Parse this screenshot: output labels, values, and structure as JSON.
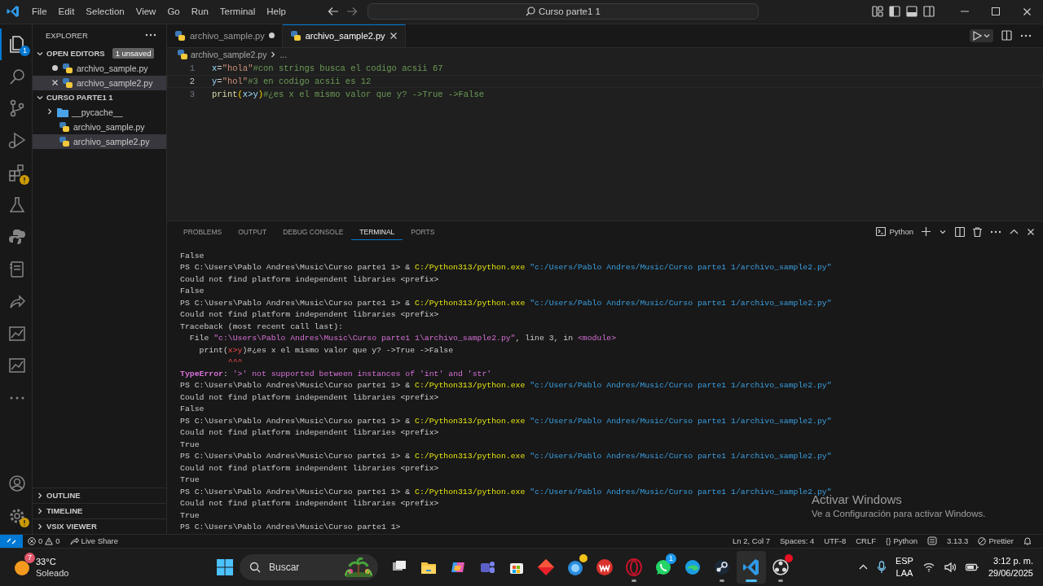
{
  "title_bar": {
    "menu": [
      "File",
      "Edit",
      "Selection",
      "View",
      "Go",
      "Run",
      "Terminal",
      "Help"
    ],
    "command_center": "Curso parte1 1"
  },
  "activity_bar": {
    "items": [
      {
        "kind": "explorer",
        "selected": true,
        "warning": false,
        "badge": "1"
      },
      {
        "kind": "search",
        "selected": false,
        "warning": false
      },
      {
        "kind": "source-control",
        "selected": false,
        "warning": false
      },
      {
        "kind": "run-debug",
        "selected": false,
        "warning": false
      },
      {
        "kind": "extensions",
        "selected": false,
        "warning": true
      },
      {
        "kind": "testing",
        "selected": false,
        "warning": false
      },
      {
        "kind": "python",
        "selected": false,
        "warning": false
      },
      {
        "kind": "notebook",
        "selected": false,
        "warning": false
      },
      {
        "kind": "live-share",
        "selected": false,
        "warning": false
      },
      {
        "kind": "chart",
        "selected": false,
        "warning": false
      },
      {
        "kind": "chart",
        "selected": false,
        "warning": false
      },
      {
        "kind": "more",
        "selected": false,
        "warning": false
      }
    ],
    "bottom": [
      {
        "kind": "account",
        "selected": false,
        "warning": false
      },
      {
        "kind": "settings",
        "selected": false,
        "warning": true
      }
    ]
  },
  "sidebar": {
    "title": "EXPLORER",
    "sections": [
      {
        "kind": "open-editors",
        "title": "OPEN EDITORS",
        "expanded": true,
        "badge": "1 unsaved",
        "items": [
          {
            "label": "archivo_sample.py",
            "kind": "python",
            "dirty": true,
            "selected": false
          },
          {
            "label": "archivo_sample2.py",
            "kind": "python",
            "dirty": false,
            "selected": true
          }
        ]
      },
      {
        "kind": "tree",
        "title": "CURSO PARTE1 1",
        "expanded": true,
        "items": [
          {
            "label": "__pycache__",
            "kind": "folder",
            "expanded": false,
            "selected": false
          },
          {
            "label": "archivo_sample.py",
            "kind": "python",
            "selected": false
          },
          {
            "label": "archivo_sample2.py",
            "kind": "python",
            "selected": true
          }
        ]
      },
      {
        "kind": "view",
        "title": "OUTLINE",
        "expanded": false
      },
      {
        "kind": "view",
        "title": "TIMELINE",
        "expanded": false
      },
      {
        "kind": "view",
        "title": "VSIX VIEWER",
        "expanded": false
      }
    ]
  },
  "editor": {
    "tabs": [
      {
        "label": "archivo_sample.py",
        "dirty": true,
        "selected": false
      },
      {
        "label": "archivo_sample2.py",
        "dirty": false,
        "selected": true
      }
    ],
    "breadcrumb": {
      "file": "archivo_sample2.py",
      "rest": "..."
    },
    "lines": [
      {
        "number": "1",
        "active": false,
        "tokens": [
          {
            "text": "x",
            "kind": "var"
          },
          {
            "text": "=",
            "kind": "op"
          },
          {
            "text": "\"hola\"",
            "kind": "str"
          },
          {
            "text": "#con strings busca el codigo acsii 67",
            "kind": "comment"
          }
        ]
      },
      {
        "number": "2",
        "active": true,
        "tokens": [
          {
            "text": "y",
            "kind": "var"
          },
          {
            "text": "=",
            "kind": "op"
          },
          {
            "text": "\"hol\"",
            "kind": "str"
          },
          {
            "text": "#3 en codigo acsii es 12",
            "kind": "comment"
          }
        ]
      },
      {
        "number": "3",
        "active": false,
        "tokens": [
          {
            "text": "print",
            "kind": "func"
          },
          {
            "text": "(",
            "kind": "bracket"
          },
          {
            "text": "x>y",
            "kind": "var"
          },
          {
            "text": ")",
            "kind": "bracket"
          },
          {
            "text": "#¿es x el mismo valor que y? ->True ->False",
            "kind": "comment"
          }
        ]
      }
    ]
  },
  "panel": {
    "tabs": [
      {
        "label": "PROBLEMS",
        "selected": false
      },
      {
        "label": "OUTPUT",
        "selected": false
      },
      {
        "label": "DEBUG CONSOLE",
        "selected": false
      },
      {
        "label": "TERMINAL",
        "selected": true
      },
      {
        "label": "PORTS",
        "selected": false
      }
    ],
    "terminal_name": "Python",
    "lines": [
      [
        {
          "text": "False",
          "kind": "plain"
        }
      ],
      [
        {
          "text": "PS C:\\Users\\Pablo Andres\\Music\\Curso parte1 1> & ",
          "kind": "plain"
        },
        {
          "text": "C:/Python313/python.exe",
          "kind": "exe"
        },
        {
          "text": " \"c:/Users/Pablo Andres/Music/Curso parte1 1/archivo_sample2.py\"",
          "kind": "arg"
        }
      ],
      [
        {
          "text": "Could not find platform independent libraries <prefix>",
          "kind": "plain"
        }
      ],
      [
        {
          "text": "False",
          "kind": "plain"
        }
      ],
      [
        {
          "text": "PS C:\\Users\\Pablo Andres\\Music\\Curso parte1 1> & ",
          "kind": "plain"
        },
        {
          "text": "C:/Python313/python.exe",
          "kind": "exe"
        },
        {
          "text": " \"c:/Users/Pablo Andres/Music/Curso parte1 1/archivo_sample2.py\"",
          "kind": "arg"
        }
      ],
      [
        {
          "text": "Could not find platform independent libraries <prefix>",
          "kind": "plain"
        }
      ],
      [
        {
          "text": "Traceback (most recent call last):",
          "kind": "plain"
        }
      ],
      [
        {
          "text": "  File ",
          "kind": "plain"
        },
        {
          "text": "\"c:\\Users\\Pablo Andres\\Music\\Curso parte1 1\\archivo_sample2.py\"",
          "kind": "path"
        },
        {
          "text": ", line 3, in ",
          "kind": "plain"
        },
        {
          "text": "<module>",
          "kind": "path"
        }
      ],
      [
        {
          "text": "    print(",
          "kind": "plain"
        },
        {
          "text": "x>y",
          "kind": "error"
        },
        {
          "text": ")#¿es x el mismo valor que y? ->True ->False",
          "kind": "plain"
        }
      ],
      [
        {
          "text": "          ^^^",
          "kind": "error"
        }
      ],
      [
        {
          "text": "TypeError",
          "kind": "errtype"
        },
        {
          "text": ": ",
          "kind": "plain"
        },
        {
          "text": "'>' not supported between instances of 'int' and 'str'",
          "kind": "path"
        }
      ],
      [
        {
          "text": "PS C:\\Users\\Pablo Andres\\Music\\Curso parte1 1> & ",
          "kind": "plain"
        },
        {
          "text": "C:/Python313/python.exe",
          "kind": "exe"
        },
        {
          "text": " \"c:/Users/Pablo Andres/Music/Curso parte1 1/archivo_sample2.py\"",
          "kind": "arg"
        }
      ],
      [
        {
          "text": "Could not find platform independent libraries <prefix>",
          "kind": "plain"
        }
      ],
      [
        {
          "text": "False",
          "kind": "plain"
        }
      ],
      [
        {
          "text": "PS C:\\Users\\Pablo Andres\\Music\\Curso parte1 1> & ",
          "kind": "plain"
        },
        {
          "text": "C:/Python313/python.exe",
          "kind": "exe"
        },
        {
          "text": " \"c:/Users/Pablo Andres/Music/Curso parte1 1/archivo_sample2.py\"",
          "kind": "arg"
        }
      ],
      [
        {
          "text": "Could not find platform independent libraries <prefix>",
          "kind": "plain"
        }
      ],
      [
        {
          "text": "True",
          "kind": "plain"
        }
      ],
      [
        {
          "text": "PS C:\\Users\\Pablo Andres\\Music\\Curso parte1 1> & ",
          "kind": "plain"
        },
        {
          "text": "C:/Python313/python.exe",
          "kind": "exe"
        },
        {
          "text": " \"c:/Users/Pablo Andres/Music/Curso parte1 1/archivo_sample2.py\"",
          "kind": "arg"
        }
      ],
      [
        {
          "text": "Could not find platform independent libraries <prefix>",
          "kind": "plain"
        }
      ],
      [
        {
          "text": "True",
          "kind": "plain"
        }
      ],
      [
        {
          "text": "PS C:\\Users\\Pablo Andres\\Music\\Curso parte1 1> & ",
          "kind": "plain"
        },
        {
          "text": "C:/Python313/python.exe",
          "kind": "exe"
        },
        {
          "text": " \"c:/Users/Pablo Andres/Music/Curso parte1 1/archivo_sample2.py\"",
          "kind": "arg"
        }
      ],
      [
        {
          "text": "Could not find platform independent libraries <prefix>",
          "kind": "plain"
        }
      ],
      [
        {
          "text": "True",
          "kind": "plain"
        }
      ],
      [
        {
          "text": "PS C:\\Users\\Pablo Andres\\Music\\Curso parte1 1>",
          "kind": "plain"
        }
      ]
    ]
  },
  "status_bar": {
    "errors": "0",
    "warnings": "0",
    "live_share": "Live Share",
    "position": "Ln 2, Col 7",
    "indent": "Spaces: 4",
    "encoding": "UTF-8",
    "eol": "CRLF",
    "language_icon": "{}",
    "language": "Python",
    "interpreter": "3.13.3",
    "formatter": "Prettier"
  },
  "activation_notice": {
    "title": "Activar Windows",
    "subtitle": "Ve a Configuración para activar Windows."
  },
  "taskbar": {
    "weather": {
      "badge": "7",
      "temperature": "33°C",
      "condition": "Soleado"
    },
    "search": "Buscar",
    "apps": [
      {
        "kind": "task-view",
        "running": false,
        "active": false,
        "notice": false
      },
      {
        "kind": "files",
        "running": false,
        "active": false,
        "notice": false
      },
      {
        "kind": "copilot",
        "running": false,
        "active": false,
        "notice": false
      },
      {
        "kind": "teams",
        "running": false,
        "active": false,
        "notice": false
      },
      {
        "kind": "store",
        "running": false,
        "active": false,
        "notice": false
      },
      {
        "kind": "diamond",
        "running": false,
        "active": false,
        "notice": false
      },
      {
        "kind": "help",
        "running": false,
        "active": false,
        "notice": true
      },
      {
        "kind": "office",
        "running": false,
        "active": false,
        "notice": false
      },
      {
        "kind": "opera",
        "running": true,
        "active": false,
        "notice": false
      },
      {
        "kind": "chat",
        "running": false,
        "active": false,
        "notice": false,
        "badge": "1"
      },
      {
        "kind": "edge",
        "running": false,
        "active": false,
        "notice": false
      },
      {
        "kind": "steam",
        "running": true,
        "active": false,
        "notice": false
      },
      {
        "kind": "vscode",
        "running": true,
        "active": true,
        "notice": false
      },
      {
        "kind": "obs",
        "running": true,
        "active": false,
        "notice": true
      }
    ],
    "language": {
      "code": "ESP",
      "layout": "LAA"
    },
    "time": "3:12 p. m.",
    "date": "29/06/2025"
  }
}
